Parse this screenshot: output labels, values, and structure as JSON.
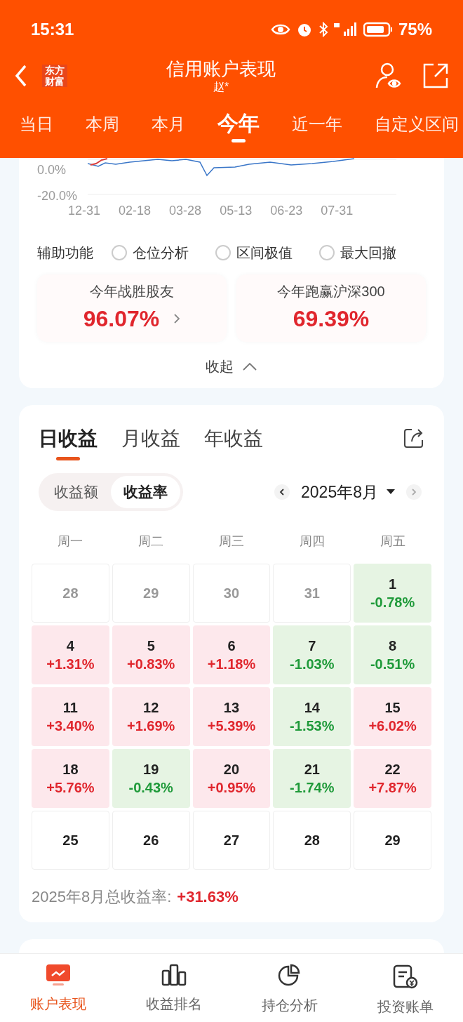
{
  "status_bar": {
    "time": "15:31",
    "battery": "75%"
  },
  "header": {
    "title": "信用账户表现",
    "subtitle": "赵*",
    "logo": "东方财富"
  },
  "period_tabs": [
    {
      "label": "当日",
      "selected": false
    },
    {
      "label": "本周",
      "selected": false
    },
    {
      "label": "本月",
      "selected": false
    },
    {
      "label": "今年",
      "selected": true
    },
    {
      "label": "近一年",
      "selected": false
    },
    {
      "label": "自定义区间",
      "selected": false
    }
  ],
  "chart": {
    "y_labels": [
      "0.0%",
      "-20.0%"
    ],
    "x_labels": [
      "12-31",
      "02-18",
      "03-28",
      "05-13",
      "06-23",
      "07-31"
    ]
  },
  "aux": {
    "label": "辅助功能",
    "options": [
      {
        "label": "仓位分析",
        "checked": false
      },
      {
        "label": "区间极值",
        "checked": false
      },
      {
        "label": "最大回撤",
        "checked": false
      }
    ]
  },
  "stats": [
    {
      "label": "今年战胜股友",
      "value": "96.07%",
      "kind": "link"
    },
    {
      "label": "今年跑赢沪深300",
      "value": "69.39%",
      "kind": "plain"
    }
  ],
  "collapse": "收起",
  "profit_tabs": [
    {
      "label": "日收益",
      "selected": true
    },
    {
      "label": "月收益",
      "selected": false
    },
    {
      "label": "年收益",
      "selected": false
    }
  ],
  "mode_toggle": [
    {
      "label": "收益额",
      "selected": false
    },
    {
      "label": "收益率",
      "selected": true
    }
  ],
  "month": "2025年8月",
  "weekdays": [
    "周一",
    "周二",
    "周三",
    "周四",
    "周五"
  ],
  "weeks": [
    {
      "days": [
        {
          "day": "28",
          "kind": "other"
        },
        {
          "day": "29",
          "kind": "other"
        },
        {
          "day": "30",
          "kind": "other"
        },
        {
          "day": "31",
          "kind": "other"
        },
        {
          "day": "1",
          "value": "-0.78%",
          "kind": "down"
        }
      ]
    },
    {
      "days": [
        {
          "day": "4",
          "value": "+1.31%",
          "kind": "up"
        },
        {
          "day": "5",
          "value": "+0.83%",
          "kind": "up"
        },
        {
          "day": "6",
          "value": "+1.18%",
          "kind": "up"
        },
        {
          "day": "7",
          "value": "-1.03%",
          "kind": "down"
        },
        {
          "day": "8",
          "value": "-0.51%",
          "kind": "down"
        }
      ]
    },
    {
      "days": [
        {
          "day": "11",
          "value": "+3.40%",
          "kind": "up"
        },
        {
          "day": "12",
          "value": "+1.69%",
          "kind": "up"
        },
        {
          "day": "13",
          "value": "+5.39%",
          "kind": "up"
        },
        {
          "day": "14",
          "value": "-1.53%",
          "kind": "down"
        },
        {
          "day": "15",
          "value": "+6.02%",
          "kind": "up"
        }
      ]
    },
    {
      "days": [
        {
          "day": "18",
          "value": "+5.76%",
          "kind": "up"
        },
        {
          "day": "19",
          "value": "-0.43%",
          "kind": "down"
        },
        {
          "day": "20",
          "value": "+0.95%",
          "kind": "up"
        },
        {
          "day": "21",
          "value": "-1.74%",
          "kind": "down"
        },
        {
          "day": "22",
          "value": "+7.87%",
          "kind": "up"
        }
      ]
    },
    {
      "days": [
        {
          "day": "25",
          "kind": "future"
        },
        {
          "day": "26",
          "kind": "future"
        },
        {
          "day": "27",
          "kind": "future"
        },
        {
          "day": "28",
          "kind": "future"
        },
        {
          "day": "29",
          "kind": "future"
        }
      ]
    }
  ],
  "summary": {
    "label": "2025年8月总收益率:",
    "value": "+31.63%"
  },
  "bottom_nav": [
    {
      "label": "账户表现",
      "selected": true
    },
    {
      "label": "收益排名",
      "selected": false
    },
    {
      "label": "持仓分析",
      "selected": false
    },
    {
      "label": "投资账单",
      "selected": false
    }
  ]
}
